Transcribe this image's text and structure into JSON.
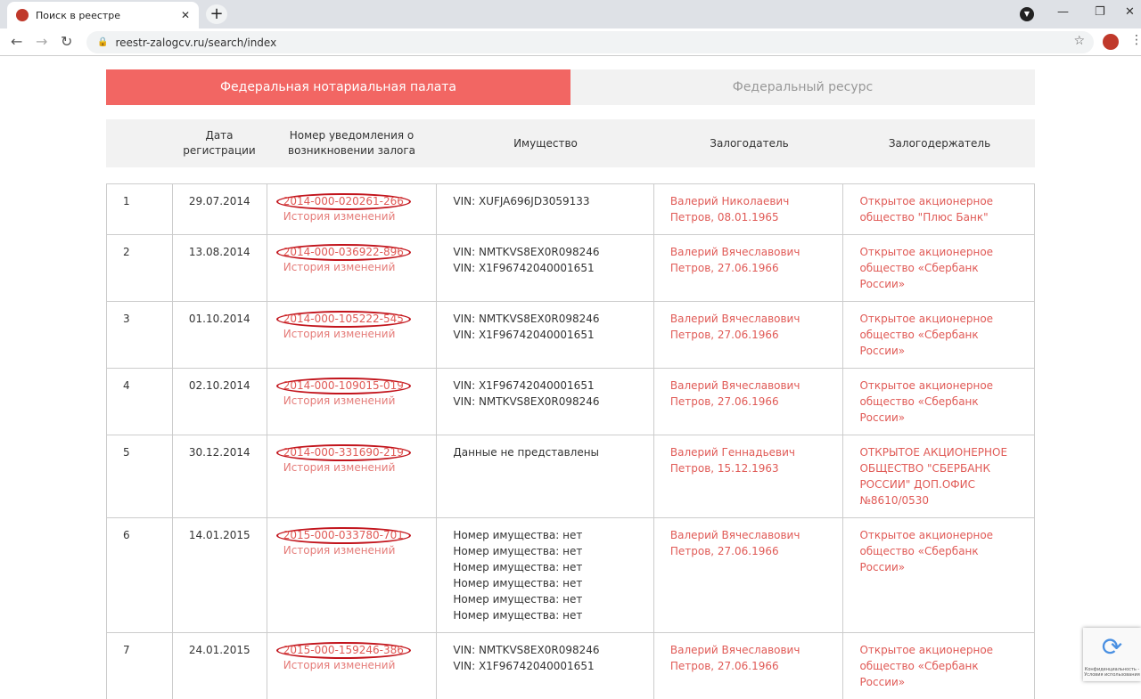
{
  "browser": {
    "tab_title": "Поиск в реестре",
    "url": "reestr-zalogcv.ru/search/index"
  },
  "switch": {
    "active": "Федеральная нотариальная палата",
    "inactive": "Федеральный ресурс"
  },
  "colors": {
    "accent": "#f26663",
    "link": "#e05a56",
    "circle": "#c2141c"
  },
  "headers": [
    "",
    "Дата регистрации",
    "Номер уведомления о возникновении залога",
    "Имущество",
    "Залогодатель",
    "Залогодержатель"
  ],
  "history_label": "История изменений",
  "rows": [
    {
      "n": "1",
      "date": "29.07.2014",
      "num": "2014-000-020261-266",
      "property": [
        "VIN: XUFJA696JD3059133"
      ],
      "pledgor": "Валерий Николаевич Петров, 08.01.1965",
      "pledgee": "Открытое акционерное общество \"Плюс Банк\""
    },
    {
      "n": "2",
      "date": "13.08.2014",
      "num": "2014-000-036922-896",
      "property": [
        "VIN: NMTKVS8EX0R098246",
        "VIN: X1F96742040001651"
      ],
      "pledgor": "Валерий Вячеславович Петров, 27.06.1966",
      "pledgee": "Открытое акционерное общество «Сбербанк России»"
    },
    {
      "n": "3",
      "date": "01.10.2014",
      "num": "2014-000-105222-545",
      "property": [
        "VIN: NMTKVS8EX0R098246",
        "VIN: X1F96742040001651"
      ],
      "pledgor": "Валерий Вячеславович Петров, 27.06.1966",
      "pledgee": "Открытое акционерное общество «Сбербанк России»"
    },
    {
      "n": "4",
      "date": "02.10.2014",
      "num": "2014-000-109015-019",
      "property": [
        "VIN: X1F96742040001651",
        "VIN: NMTKVS8EX0R098246"
      ],
      "pledgor": "Валерий Вячеславович Петров, 27.06.1966",
      "pledgee": "Открытое акционерное общество «Сбербанк России»"
    },
    {
      "n": "5",
      "date": "30.12.2014",
      "num": "2014-000-331690-219",
      "property": [
        "Данные не представлены"
      ],
      "pledgor": "Валерий Геннадьевич Петров, 15.12.1963",
      "pledgee": "ОТКРЫТОЕ АКЦИОНЕРНОЕ ОБЩЕСТВО \"СБЕРБАНК РОССИИ\" ДОП.ОФИС №8610/0530"
    },
    {
      "n": "6",
      "date": "14.01.2015",
      "num": "2015-000-033780-701",
      "property": [
        "Номер имущества: нет",
        "Номер имущества: нет",
        "Номер имущества: нет",
        "Номер имущества: нет",
        "Номер имущества: нет",
        "Номер имущества: нет"
      ],
      "pledgor": "Валерий Вячеславович Петров, 27.06.1966",
      "pledgee": "Открытое акционерное общество «Сбербанк России»"
    },
    {
      "n": "7",
      "date": "24.01.2015",
      "num": "2015-000-159246-386",
      "property": [
        "VIN: NMTKVS8EX0R098246",
        "VIN: X1F96742040001651"
      ],
      "pledgor": "Валерий Вячеславович Петров, 27.06.1966",
      "pledgee": "Открытое акционерное общество «Сбербанк России»"
    }
  ],
  "captcha": {
    "text": "Конфиденциальность - Условия использования"
  }
}
